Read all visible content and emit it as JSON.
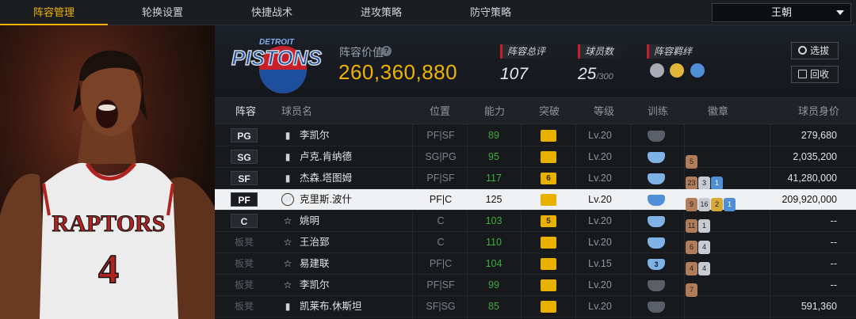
{
  "nav": {
    "tabs": [
      "阵容管理",
      "轮换设置",
      "快捷战术",
      "进攻策略",
      "防守策略"
    ],
    "active_tab": "阵容管理",
    "team_select": "王朝"
  },
  "header": {
    "logo_top_text": "DETROIT",
    "logo_main_text": "PISTONS",
    "value_label": "阵容价值",
    "value": "260,360,880",
    "rating_label": "阵容总评",
    "rating": "107",
    "count_label": "球员数",
    "count": "25",
    "count_max": "/300",
    "bond_label": "阵容羁绊",
    "select_button": "选拔",
    "recycle_button": "回收"
  },
  "portrait": {
    "jersey_team": "RAPTORS",
    "jersey_number": "4"
  },
  "table": {
    "headers": [
      "阵容",
      "球员名",
      "位置",
      "能力",
      "突破",
      "等级",
      "训练",
      "徽章",
      "球员身价"
    ],
    "rows": [
      {
        "slot": "PG",
        "bench": false,
        "icon": "bars",
        "name": "李凯尔",
        "pos": "PF|SF",
        "ability": "89",
        "breakthrough": "",
        "level": "Lv.20",
        "training": "",
        "training_color": "#5b6068",
        "badges": [],
        "salary": "279,680",
        "selected": false
      },
      {
        "slot": "SG",
        "bench": false,
        "icon": "bars",
        "name": "卢克.肯纳德",
        "pos": "SG|PG",
        "ability": "95",
        "breakthrough": "",
        "level": "Lv.20",
        "training": "",
        "training_color": "#7fb2e5",
        "badges": [
          {
            "t": "5",
            "c": "b-bronze"
          }
        ],
        "salary": "2,035,200",
        "selected": false
      },
      {
        "slot": "SF",
        "bench": false,
        "icon": "bars",
        "name": "杰森.塔图姆",
        "pos": "PF|SF",
        "ability": "117",
        "breakthrough": "6",
        "level": "Lv.20",
        "training": "",
        "training_color": "#7fb2e5",
        "badges": [
          {
            "t": "23",
            "c": "b-bronze"
          },
          {
            "t": "3",
            "c": "b-silver"
          },
          {
            "t": "1",
            "c": "b-blue"
          }
        ],
        "salary": "41,280,000",
        "selected": false
      },
      {
        "slot": "PF",
        "bench": false,
        "icon": "07",
        "name": "克里斯.波什",
        "pos": "PF|C",
        "ability": "125",
        "breakthrough": "",
        "level": "Lv.20",
        "training": "",
        "training_color": "#4f8fd6",
        "badges": [
          {
            "t": "9",
            "c": "b-bronze"
          },
          {
            "t": "16",
            "c": "b-silver"
          },
          {
            "t": "2",
            "c": "b-gold"
          },
          {
            "t": "1",
            "c": "b-blue"
          }
        ],
        "salary": "209,920,000",
        "selected": true
      },
      {
        "slot": "C",
        "bench": false,
        "icon": "star",
        "name": "姚明",
        "pos": "C",
        "ability": "103",
        "breakthrough": "5",
        "level": "Lv.20",
        "training": "",
        "training_color": "#7fb2e5",
        "badges": [
          {
            "t": "11",
            "c": "b-bronze"
          },
          {
            "t": "1",
            "c": "b-silver"
          }
        ],
        "salary": "--",
        "selected": false
      },
      {
        "slot": "板凳",
        "bench": true,
        "icon": "star",
        "name": "王治郅",
        "pos": "C",
        "ability": "110",
        "breakthrough": "",
        "level": "Lv.20",
        "training": "",
        "training_color": "#7fb2e5",
        "badges": [
          {
            "t": "6",
            "c": "b-bronze"
          },
          {
            "t": "4",
            "c": "b-silver"
          }
        ],
        "salary": "--",
        "selected": false
      },
      {
        "slot": "板凳",
        "bench": true,
        "icon": "star",
        "name": "易建联",
        "pos": "PF|C",
        "ability": "104",
        "breakthrough": "",
        "level": "Lv.15",
        "training": "3",
        "training_color": "#7fb2e5",
        "badges": [
          {
            "t": "4",
            "c": "b-bronze"
          },
          {
            "t": "4",
            "c": "b-silver"
          }
        ],
        "salary": "--",
        "selected": false
      },
      {
        "slot": "板凳",
        "bench": true,
        "icon": "star",
        "name": "李凯尔",
        "pos": "PF|SF",
        "ability": "99",
        "breakthrough": "",
        "level": "Lv.20",
        "training": "",
        "training_color": "#5b6068",
        "badges": [
          {
            "t": "7",
            "c": "b-bronze"
          }
        ],
        "salary": "--",
        "selected": false
      },
      {
        "slot": "板凳",
        "bench": true,
        "icon": "bars",
        "name": "凯莱布.休斯坦",
        "pos": "SF|SG",
        "ability": "85",
        "breakthrough": "",
        "level": "Lv.20",
        "training": "",
        "training_color": "#5b6068",
        "badges": [],
        "salary": "591,360",
        "selected": false
      }
    ]
  },
  "colors": {
    "accent": "#f0b400",
    "ability_green": "#3fae3f",
    "stat_red": "#c8202a"
  }
}
